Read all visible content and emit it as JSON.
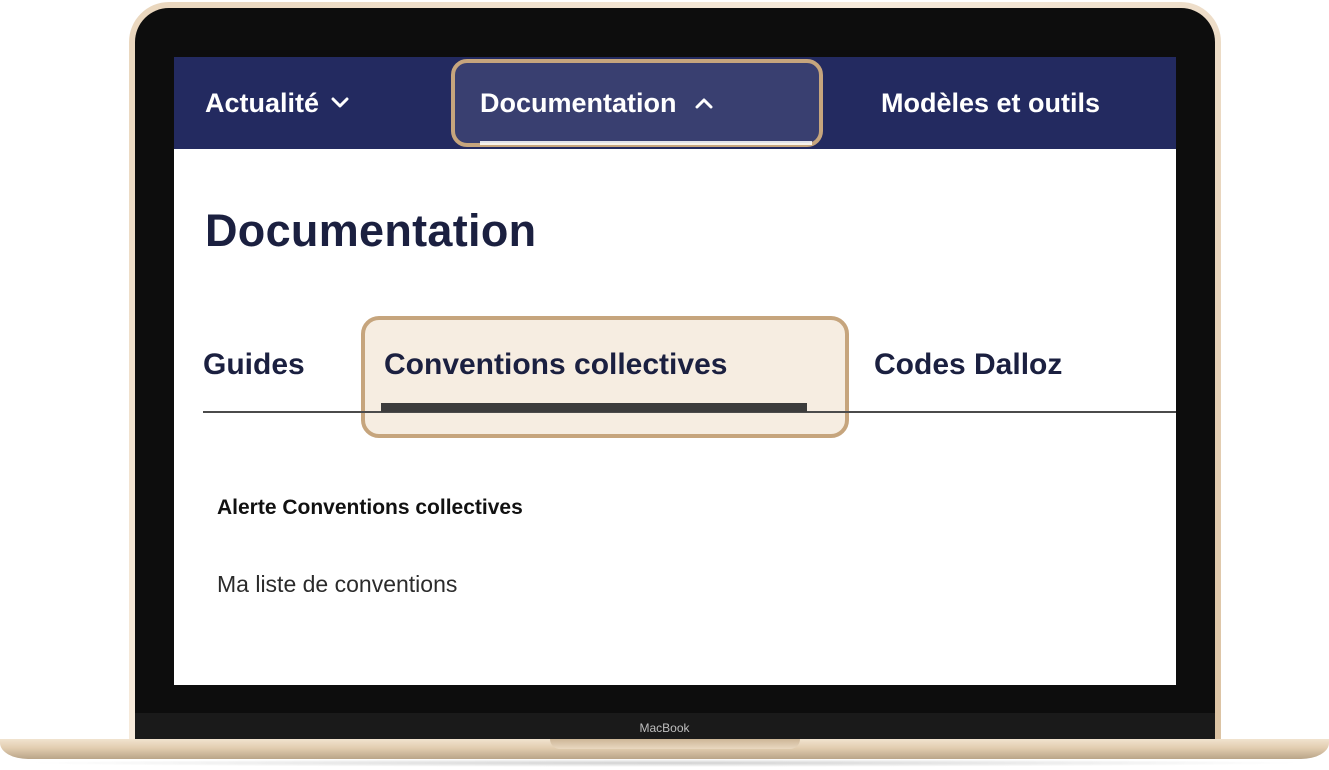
{
  "device": {
    "label": "MacBook"
  },
  "topnav": {
    "items": [
      {
        "label": "Actualité",
        "icon": "chevron-down-icon"
      },
      {
        "label": "Documentation",
        "icon": "chevron-up-icon"
      },
      {
        "label": "Modèles et outils"
      }
    ]
  },
  "page": {
    "title": "Documentation"
  },
  "tabs": [
    {
      "label": "Guides"
    },
    {
      "label": "Conventions collectives",
      "active": true
    },
    {
      "label": "Codes Dalloz"
    }
  ],
  "content": {
    "alert_label": "Alerte Conventions collectives",
    "list_link": "Ma liste de conventions"
  },
  "colors": {
    "nav_background": "#232a60",
    "highlight_border": "#c6a57d",
    "highlight_fill": "#f6ede1",
    "title_text": "#1b2040"
  }
}
